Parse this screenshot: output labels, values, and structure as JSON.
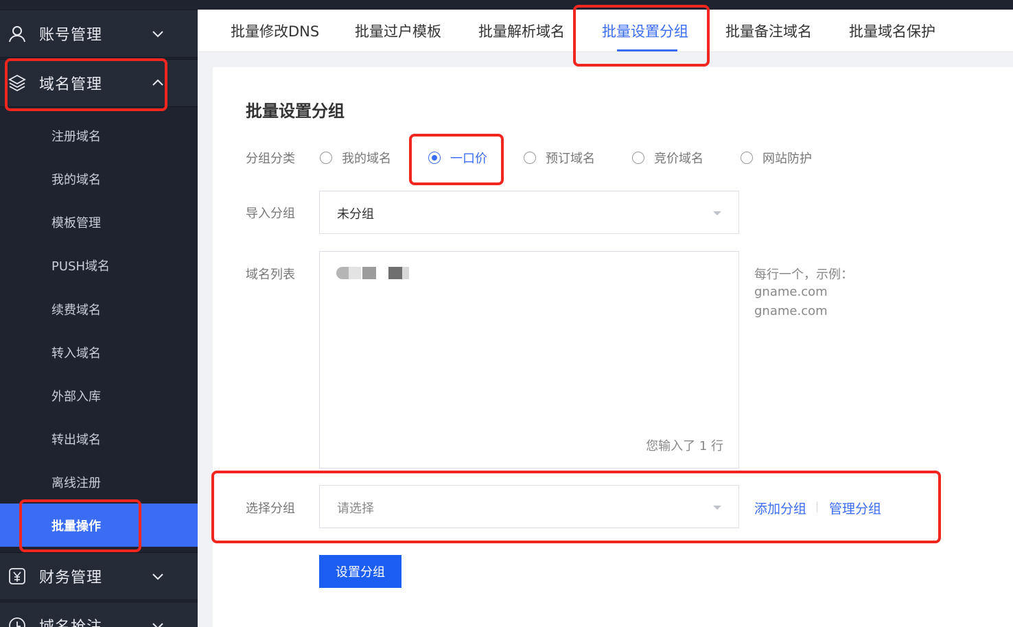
{
  "sidebar": {
    "groups": [
      {
        "label": "账号管理",
        "icon": "user-icon"
      },
      {
        "label": "域名管理",
        "icon": "layers-icon"
      },
      {
        "label": "财务管理",
        "icon": "yen-receipt-icon"
      },
      {
        "label": "域名抢注",
        "icon": "clock-icon"
      }
    ],
    "items": [
      "注册域名",
      "我的域名",
      "模板管理",
      "PUSH域名",
      "续费域名",
      "转入域名",
      "外部入库",
      "转出域名",
      "离线注册",
      "批量操作"
    ]
  },
  "tabs": [
    "批量修改DNS",
    "批量过户模板",
    "批量解析域名",
    "批量设置分组",
    "批量备注域名",
    "批量域名保护"
  ],
  "active_tab": "批量设置分组",
  "form": {
    "title": "批量设置分组",
    "category_label": "分组分类",
    "categories": [
      "我的域名",
      "一口价",
      "预订域名",
      "竞价域名",
      "网站防护"
    ],
    "selected_category": "一口价",
    "import_label": "导入分组",
    "import_value": "未分组",
    "domains_label": "域名列表",
    "domains_count": "您输入了 1 行",
    "hint_lines": [
      "每行一个，示例：",
      "gname.com",
      "gname.com"
    ],
    "group_label": "选择分组",
    "group_placeholder": "请选择",
    "add_group": "添加分组",
    "manage_group": "管理分组",
    "submit": "设置分组"
  },
  "colors": {
    "accent": "#3b6cf4",
    "sidebar_bg": "#1f2330",
    "highlight": "#f1261e"
  }
}
